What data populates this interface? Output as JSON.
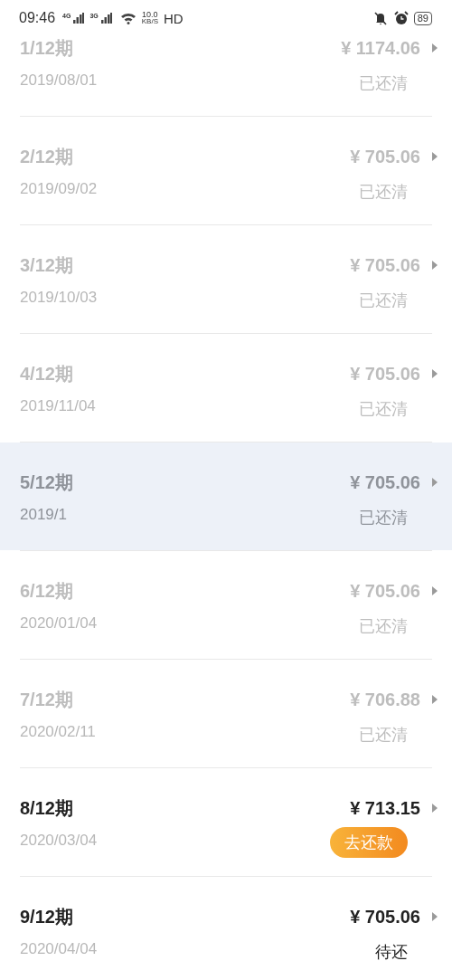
{
  "status_bar": {
    "time": "09:46",
    "network_1": "4G",
    "network_2": "3G",
    "speed_value": "10.0",
    "speed_unit": "KB/S",
    "hd": "HD",
    "battery": "89"
  },
  "installments": [
    {
      "period": "1/12期",
      "date": "2019/08/01",
      "amount": "¥ 1174.06",
      "kind": "paid",
      "status": "已还清",
      "obscured": false
    },
    {
      "period": "2/12期",
      "date": "2019/09/02",
      "amount": "¥ 705.06",
      "kind": "paid",
      "status": "已还清",
      "obscured": false
    },
    {
      "period": "3/12期",
      "date": "2019/10/03",
      "amount": "¥ 705.06",
      "kind": "paid",
      "status": "已还清",
      "obscured": false
    },
    {
      "period": "4/12期",
      "date": "2019/11/04",
      "amount": "¥ 705.06",
      "kind": "paid",
      "status": "已还清",
      "obscured": false
    },
    {
      "period": "5/12期",
      "date": "2019/1",
      "amount": "¥ 705.06",
      "kind": "paid",
      "status": "已还清",
      "obscured": true
    },
    {
      "period": "6/12期",
      "date": "2020/01/04",
      "amount": "¥ 705.06",
      "kind": "paid",
      "status": "已还清",
      "obscured": false
    },
    {
      "period": "7/12期",
      "date": "2020/02/11",
      "amount": "¥ 706.88",
      "kind": "paid",
      "status": "已还清",
      "obscured": false
    },
    {
      "period": "8/12期",
      "date": "2020/03/04",
      "amount": "¥ 713.15",
      "kind": "due",
      "status": "去还款",
      "obscured": false
    },
    {
      "period": "9/12期",
      "date": "2020/04/04",
      "amount": "¥ 705.06",
      "kind": "pending",
      "status": "待还",
      "obscured": false
    }
  ]
}
